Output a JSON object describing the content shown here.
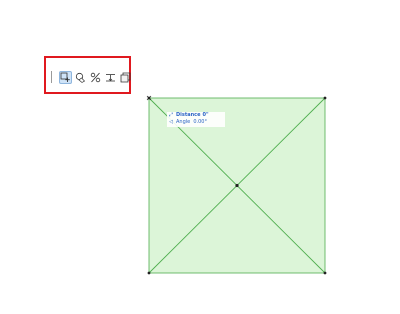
{
  "toolbar": {
    "buttons": [
      {
        "icon": "add-to-polygon-icon",
        "active": true
      },
      {
        "icon": "subtract-from-polygon-icon",
        "active": false
      },
      {
        "icon": "split-icon",
        "active": false
      },
      {
        "icon": "offset-edge-icon",
        "active": false
      },
      {
        "icon": "offset-all-edges-icon",
        "active": false
      }
    ],
    "highlight_color": "#e0191f"
  },
  "tracker": {
    "distance_label": "Distance",
    "distance_value": "0\"",
    "angle_label": "Angle",
    "angle_value": "0.00°"
  },
  "shape": {
    "fill_color": "#dcf5d8",
    "stroke_color": "#4fae4f"
  }
}
